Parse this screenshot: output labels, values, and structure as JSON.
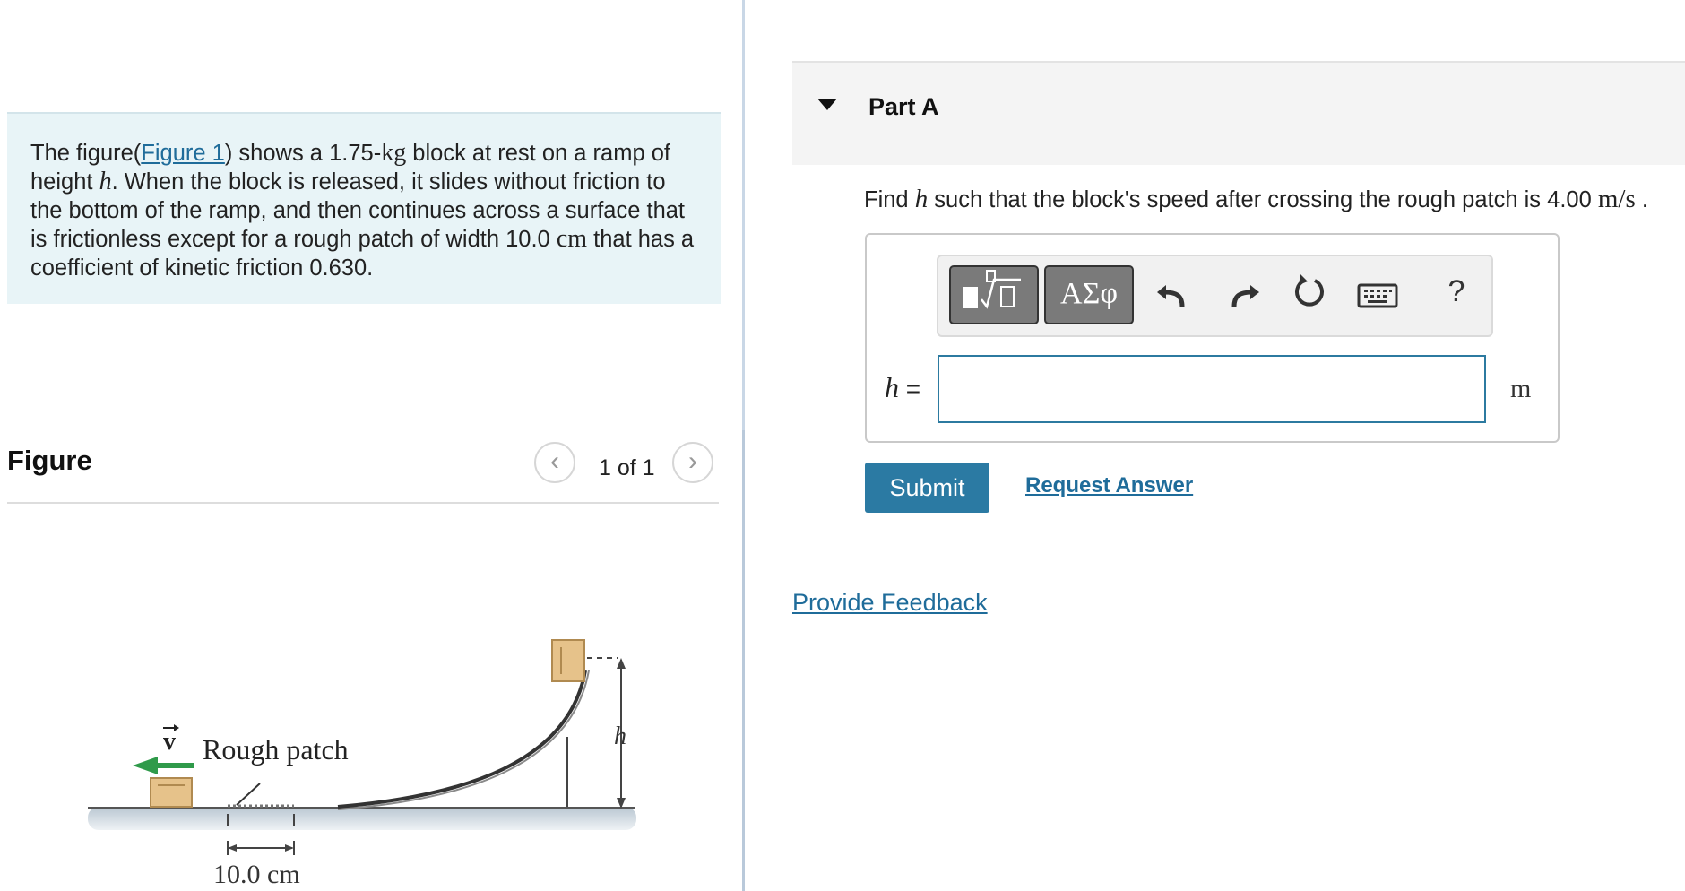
{
  "problem": {
    "text_1": "The figure(",
    "figure_link": "Figure 1",
    "text_2": ") shows a 1.75-",
    "mass_unit": "kg",
    "text_3": " block at rest on a ramp of height ",
    "var_h": "h",
    "text_4": ". When the block is released, it slides without friction to the bottom of the ramp, and then continues across a surface that is frictionless except for a rough patch of width 10.0 ",
    "width_unit": "cm",
    "text_5": " that has a coefficient of kinetic friction 0.630."
  },
  "figure": {
    "title": "Figure",
    "counter": "1 of 1",
    "prev_glyph": "‹",
    "next_glyph": "›",
    "label_v": "v",
    "label_rough_patch": "Rough patch",
    "label_h": "h",
    "label_width": "10.0 cm",
    "colors": {
      "arrow": "#2f9a4a",
      "block": "#e6c28a",
      "ground": "#c7d3dd"
    }
  },
  "part": {
    "title": "Part A",
    "question_1": "Find ",
    "question_var": "h",
    "question_2": " such that the block's speed after crossing the rough patch is 4.00 ",
    "question_unit": "m/s",
    "question_3": " ."
  },
  "toolbar": {
    "symbols_label": "ΑΣφ",
    "help_label": "?",
    "icons": [
      "templates-icon",
      "undo-icon",
      "redo-icon",
      "reset-icon",
      "keyboard-icon",
      "help-icon"
    ]
  },
  "answer": {
    "var": "h",
    "equals": " =",
    "value": "",
    "unit": "m"
  },
  "actions": {
    "submit": "Submit",
    "request_answer": "Request Answer",
    "provide_feedback": "Provide Feedback"
  },
  "colors": {
    "accent": "#2b7aa3",
    "link": "#1f6c9a",
    "problem_bg": "#e8f4f7"
  }
}
